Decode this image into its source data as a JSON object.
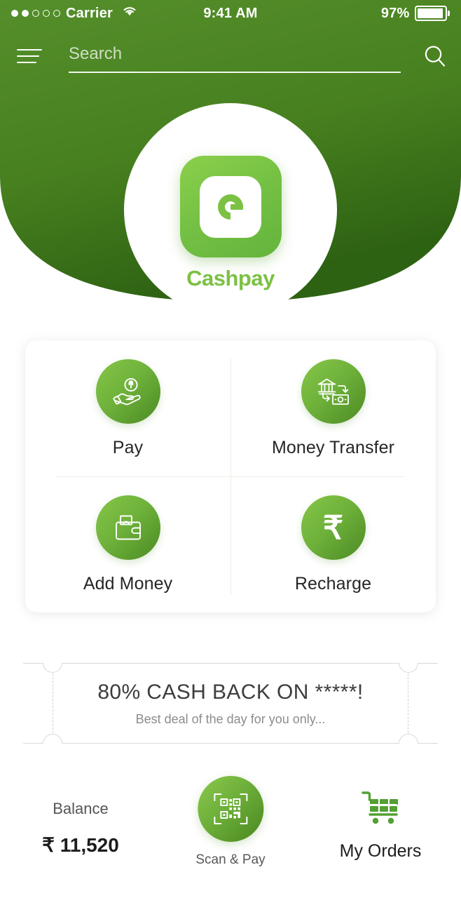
{
  "status_bar": {
    "signal_dots_filled": 2,
    "signal_dots_total": 5,
    "carrier": "Carrier",
    "wifi_icon": "wifi-icon",
    "time": "9:41 AM",
    "battery_percent": "97%",
    "battery_icon": "battery-icon"
  },
  "header": {
    "menu_icon": "hamburger-menu-icon",
    "search": {
      "value": "",
      "placeholder": "Search",
      "icon": "search-icon"
    },
    "brand": {
      "app_name": "Cashpay",
      "logo_icon": "cashpay-logo-icon",
      "accent_color": "#7BC143",
      "header_color_top": "#4E8B27",
      "header_color_bottom": "#2F6415"
    }
  },
  "actions": {
    "items": [
      {
        "label": "Pay",
        "icon": "hand-holding-money-icon"
      },
      {
        "label": "Money Transfer",
        "icon": "bank-transfer-icon"
      },
      {
        "label": "Add Money",
        "icon": "wallet-icon"
      },
      {
        "label": "Recharge",
        "icon": "rupee-icon",
        "glyph": "₹"
      }
    ],
    "circle_gradient_from": "#86C648",
    "circle_gradient_to": "#4C8A24"
  },
  "coupon": {
    "title": "80% CASH BACK ON *****!",
    "subtitle": "Best deal of the day for you only..."
  },
  "bottom_bar": {
    "balance_label": "Balance",
    "balance_amount": "₹ 11,520",
    "scan_label": "Scan & Pay",
    "scan_icon": "qr-scan-icon",
    "orders_label": "My Orders",
    "orders_icon": "shopping-cart-icon",
    "cart_color": "#54A033"
  }
}
